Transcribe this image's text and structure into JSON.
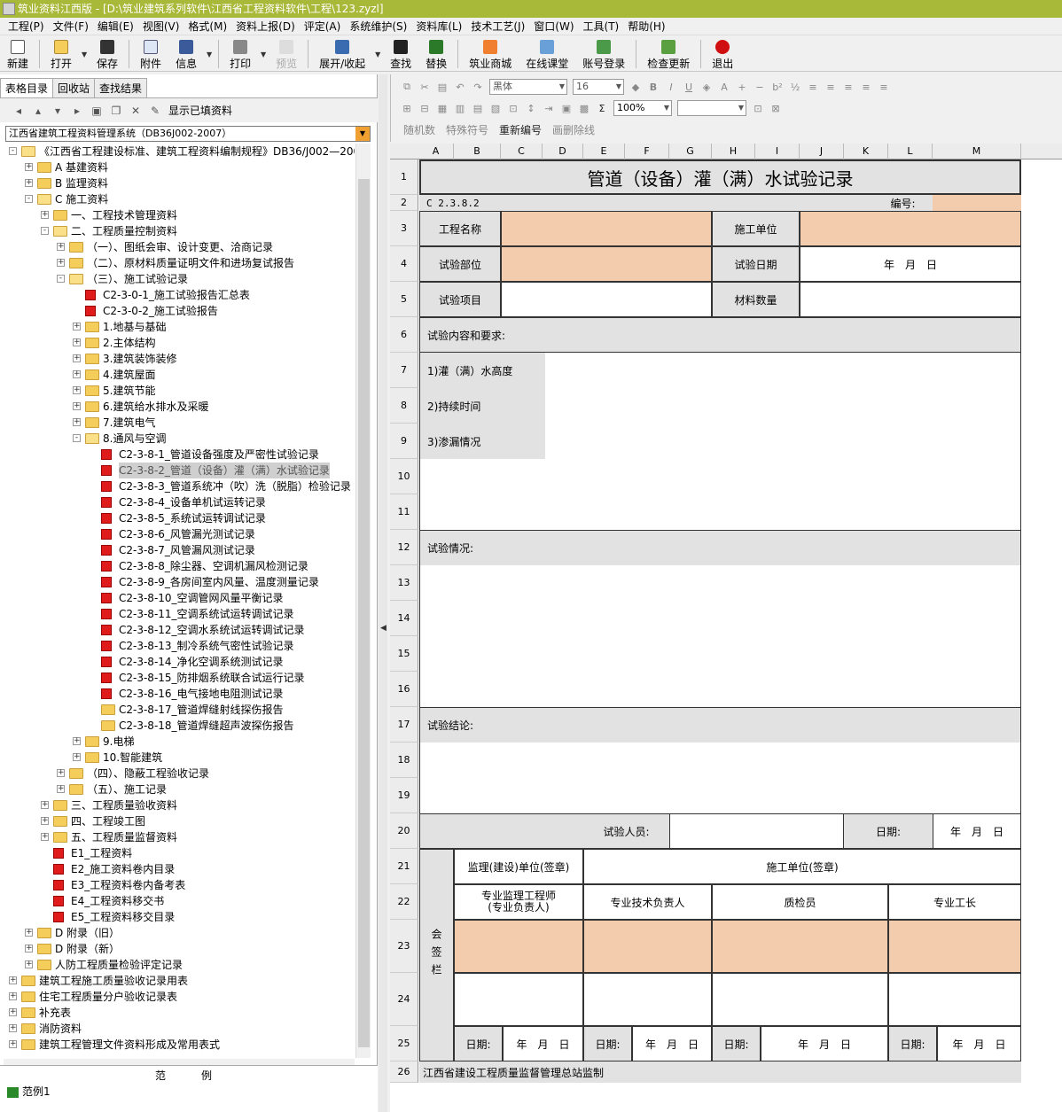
{
  "window": {
    "title": "筑业资料江西版 - [D:\\筑业建筑系列软件\\江西省工程资料软件\\工程\\123.zyzl]"
  },
  "menu": [
    "工程(P)",
    "文件(F)",
    "编辑(E)",
    "视图(V)",
    "格式(M)",
    "资料上报(D)",
    "评定(A)",
    "系统维护(S)",
    "资料库(L)",
    "技术工艺(J)",
    "窗口(W)",
    "工具(T)",
    "帮助(H)"
  ],
  "toolbar": {
    "new": "新建",
    "open": "打开",
    "save": "保存",
    "attach": "附件",
    "info": "信息",
    "print": "打印",
    "preview": "预览",
    "expand": "展开/收起",
    "find": "查找",
    "replace": "替换",
    "mall": "筑业商城",
    "classroom": "在线课堂",
    "login": "账号登录",
    "update": "检查更新",
    "exit": "退出"
  },
  "left": {
    "tabs": [
      "表格目录",
      "回收站",
      "查找结果"
    ],
    "show_filled": "显示已填资料",
    "system": "江西省建筑工程资料管理系统（DB36J002-2007）",
    "legend_title": "范例",
    "legend_item": "范例1"
  },
  "tree": [
    {
      "level": 0,
      "toggle": "-",
      "icon": "folderopen",
      "text": "《江西省工程建设标准、建筑工程资料编制规程》DB36/J002—2007"
    },
    {
      "level": 1,
      "toggle": "+",
      "icon": "folder",
      "text": "A 基建资料"
    },
    {
      "level": 1,
      "toggle": "+",
      "icon": "folder",
      "text": "B 监理资料"
    },
    {
      "level": 1,
      "toggle": "-",
      "icon": "folderopen",
      "text": "C 施工资料"
    },
    {
      "level": 2,
      "toggle": "+",
      "icon": "folder",
      "text": "一、工程技术管理资料"
    },
    {
      "level": 2,
      "toggle": "-",
      "icon": "folderopen",
      "text": "二、工程质量控制资料"
    },
    {
      "level": 3,
      "toggle": "+",
      "icon": "folder",
      "text": "（一）、图纸会审、设计变更、洽商记录"
    },
    {
      "level": 3,
      "toggle": "+",
      "icon": "folder",
      "text": "（二）、原材料质量证明文件和进场复试报告"
    },
    {
      "level": 3,
      "toggle": "-",
      "icon": "folderopen",
      "text": "（三）、施工试验记录"
    },
    {
      "level": 4,
      "toggle": "",
      "icon": "doc",
      "text": "C2-3-0-1_施工试验报告汇总表"
    },
    {
      "level": 4,
      "toggle": "",
      "icon": "doc",
      "text": "C2-3-0-2_施工试验报告"
    },
    {
      "level": 4,
      "toggle": "+",
      "icon": "folder",
      "text": "1.地基与基础"
    },
    {
      "level": 4,
      "toggle": "+",
      "icon": "folder",
      "text": "2.主体结构"
    },
    {
      "level": 4,
      "toggle": "+",
      "icon": "folder",
      "text": "3.建筑装饰装修"
    },
    {
      "level": 4,
      "toggle": "+",
      "icon": "folder",
      "text": "4.建筑屋面"
    },
    {
      "level": 4,
      "toggle": "+",
      "icon": "folder",
      "text": "5.建筑节能"
    },
    {
      "level": 4,
      "toggle": "+",
      "icon": "folder",
      "text": "6.建筑给水排水及采暖"
    },
    {
      "level": 4,
      "toggle": "+",
      "icon": "folder",
      "text": "7.建筑电气"
    },
    {
      "level": 4,
      "toggle": "-",
      "icon": "folderopen",
      "text": "8.通风与空调"
    },
    {
      "level": 5,
      "toggle": "",
      "icon": "doc",
      "text": "C2-3-8-1_管道设备强度及严密性试验记录"
    },
    {
      "level": 5,
      "toggle": "",
      "icon": "doc",
      "text": "C2-3-8-2_管道（设备）灌（满）水试验记录",
      "selected": true
    },
    {
      "level": 5,
      "toggle": "",
      "icon": "doc",
      "text": "C2-3-8-3_管道系统冲（吹）洗（脱脂）检验记录"
    },
    {
      "level": 5,
      "toggle": "",
      "icon": "doc",
      "text": "C2-3-8-4_设备单机试运转记录"
    },
    {
      "level": 5,
      "toggle": "",
      "icon": "doc",
      "text": "C2-3-8-5_系统试运转调试记录"
    },
    {
      "level": 5,
      "toggle": "",
      "icon": "doc",
      "text": "C2-3-8-6_风管漏光测试记录"
    },
    {
      "level": 5,
      "toggle": "",
      "icon": "doc",
      "text": "C2-3-8-7_风管漏风测试记录"
    },
    {
      "level": 5,
      "toggle": "",
      "icon": "doc",
      "text": "C2-3-8-8_除尘器、空调机漏风检测记录"
    },
    {
      "level": 5,
      "toggle": "",
      "icon": "doc",
      "text": "C2-3-8-9_各房间室内风量、温度测量记录"
    },
    {
      "level": 5,
      "toggle": "",
      "icon": "doc",
      "text": "C2-3-8-10_空调管网风量平衡记录"
    },
    {
      "level": 5,
      "toggle": "",
      "icon": "doc",
      "text": "C2-3-8-11_空调系统试运转调试记录"
    },
    {
      "level": 5,
      "toggle": "",
      "icon": "doc",
      "text": "C2-3-8-12_空调水系统试运转调试记录"
    },
    {
      "level": 5,
      "toggle": "",
      "icon": "doc",
      "text": "C2-3-8-13_制冷系统气密性试验记录"
    },
    {
      "level": 5,
      "toggle": "",
      "icon": "doc",
      "text": "C2-3-8-14_净化空调系统测试记录"
    },
    {
      "level": 5,
      "toggle": "",
      "icon": "doc",
      "text": "C2-3-8-15_防排烟系统联合试运行记录"
    },
    {
      "level": 5,
      "toggle": "",
      "icon": "doc",
      "text": "C2-3-8-16_电气接地电阻测试记录"
    },
    {
      "level": 5,
      "toggle": "",
      "icon": "folder",
      "text": "C2-3-8-17_管道焊缝射线探伤报告"
    },
    {
      "level": 5,
      "toggle": "",
      "icon": "folder",
      "text": "C2-3-8-18_管道焊缝超声波探伤报告"
    },
    {
      "level": 4,
      "toggle": "+",
      "icon": "folder",
      "text": "9.电梯"
    },
    {
      "level": 4,
      "toggle": "+",
      "icon": "folder",
      "text": "10.智能建筑"
    },
    {
      "level": 3,
      "toggle": "+",
      "icon": "folder",
      "text": "（四）、隐蔽工程验收记录"
    },
    {
      "level": 3,
      "toggle": "+",
      "icon": "folder",
      "text": "（五）、施工记录"
    },
    {
      "level": 2,
      "toggle": "+",
      "icon": "folder",
      "text": "三、工程质量验收资料"
    },
    {
      "level": 2,
      "toggle": "+",
      "icon": "folder",
      "text": "四、工程竣工图"
    },
    {
      "level": 2,
      "toggle": "+",
      "icon": "folder",
      "text": "五、工程质量监督资料"
    },
    {
      "level": 2,
      "toggle": "",
      "icon": "doc",
      "text": "E1_工程资料"
    },
    {
      "level": 2,
      "toggle": "",
      "icon": "doc",
      "text": "E2_施工资料卷内目录"
    },
    {
      "level": 2,
      "toggle": "",
      "icon": "doc",
      "text": "E3_工程资料卷内备考表"
    },
    {
      "level": 2,
      "toggle": "",
      "icon": "doc",
      "text": "E4_工程资料移交书"
    },
    {
      "level": 2,
      "toggle": "",
      "icon": "doc",
      "text": "E5_工程资料移交目录"
    },
    {
      "level": 1,
      "toggle": "+",
      "icon": "folder",
      "text": "D 附录（旧）"
    },
    {
      "level": 1,
      "toggle": "+",
      "icon": "folder",
      "text": "D 附录（新）"
    },
    {
      "level": 1,
      "toggle": "+",
      "icon": "folder",
      "text": "人防工程质量检验评定记录"
    },
    {
      "level": 0,
      "toggle": "+",
      "icon": "folder",
      "text": "建筑工程施工质量验收记录用表"
    },
    {
      "level": 0,
      "toggle": "+",
      "icon": "folder",
      "text": "住宅工程质量分户验收记录表"
    },
    {
      "level": 0,
      "toggle": "+",
      "icon": "folder",
      "text": "补充表"
    },
    {
      "level": 0,
      "toggle": "+",
      "icon": "folder",
      "text": "消防资料"
    },
    {
      "level": 0,
      "toggle": "+",
      "icon": "folder",
      "text": "建筑工程管理文件资料形成及常用表式"
    }
  ],
  "format": {
    "font": "黑体",
    "size": "16",
    "zoom": "100%",
    "random": "随机数",
    "special": "特殊符号",
    "renumber": "重新编号",
    "strike": "画删除线"
  },
  "sheet": {
    "columns": [
      "A",
      "B",
      "C",
      "D",
      "E",
      "F",
      "G",
      "H",
      "I",
      "J",
      "K",
      "L",
      "M"
    ],
    "rows": [
      "1",
      "2",
      "3",
      "4",
      "5",
      "6",
      "7",
      "8",
      "9",
      "10",
      "11",
      "12",
      "13",
      "14",
      "15",
      "16",
      "17",
      "18",
      "19",
      "20",
      "21",
      "22",
      "23",
      "24",
      "25",
      "26"
    ],
    "title": "管道（设备）灌（满）水试验记录",
    "code": "C 2.3.8.2",
    "number_label": "编号:",
    "project_name": "工程名称",
    "contractor": "施工单位",
    "test_location": "试验部位",
    "test_date": "试验日期",
    "date_placeholder": "年　月　日",
    "test_item": "试验项目",
    "material_qty": "材料数量",
    "content_req": "试验内容和要求:",
    "item1": "1)灌（满）水高度",
    "item2": "2)持续时间",
    "item3": "3)渗漏情况",
    "situation": "试验情况:",
    "conclusion": "试验结论:",
    "tester": "试验人员:",
    "date_label": "日期:",
    "sign_col": "会签栏",
    "supervisor_unit": "监理(建设)单位(签章)",
    "contractor_sign": "施工单位(签章)",
    "supervisor_engineer": "专业监理工程师\n(专业负责人)",
    "tech_lead": "专业技术负责人",
    "inspector": "质检员",
    "foreman": "专业工长",
    "sign_date": "日期:",
    "footer": "江西省建设工程质量监督管理总站监制"
  }
}
